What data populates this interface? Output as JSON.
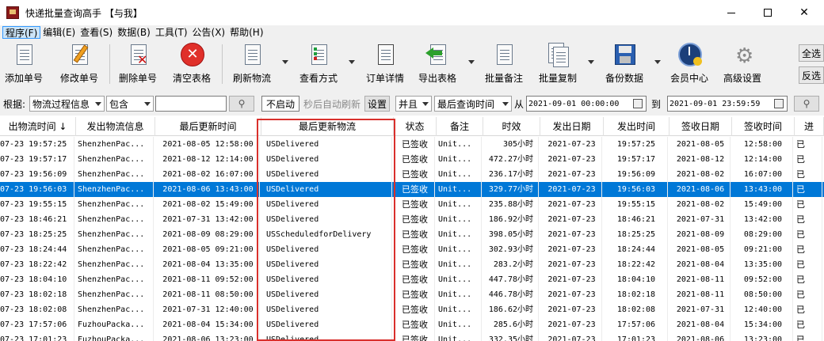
{
  "window": {
    "title": "快递批量查询高手 【与我】"
  },
  "menu": [
    {
      "label": "程序(F)",
      "active": true
    },
    {
      "label": "编辑(E)"
    },
    {
      "label": "查看(S)"
    },
    {
      "label": "数据(B)"
    },
    {
      "label": "工具(T)"
    },
    {
      "label": "公告(X)"
    },
    {
      "label": "帮助(H)"
    }
  ],
  "toolbar": {
    "buttons": [
      {
        "label": "添加单号",
        "icon": "document-icon"
      },
      {
        "label": "修改单号",
        "icon": "pencil-icon"
      },
      {
        "label": "删除单号",
        "icon": "delete-icon"
      },
      {
        "label": "清空表格",
        "icon": "clear-icon"
      },
      {
        "label": "刷新物流",
        "icon": "refresh-icon"
      },
      {
        "label": "查看方式",
        "icon": "view-icon"
      },
      {
        "label": "订单详情",
        "icon": "details-icon"
      },
      {
        "label": "导出表格",
        "icon": "export-icon"
      },
      {
        "label": "批量备注",
        "icon": "note-icon"
      },
      {
        "label": "批量复制",
        "icon": "copy-icon"
      },
      {
        "label": "备份数据",
        "icon": "save-icon"
      },
      {
        "label": "会员中心",
        "icon": "member-icon"
      },
      {
        "label": "高级设置",
        "icon": "gear-icon"
      }
    ],
    "select_all": "全选",
    "invert": "反选"
  },
  "filter": {
    "by_label": "根据:",
    "field": "物流过程信息",
    "op": "包含",
    "value": "",
    "auto_refresh": "不启动",
    "auto_refresh_hint": "秒后自动刷新",
    "settings": "设置",
    "logic": "并且",
    "time_field": "最后查询时间",
    "from_label": "从",
    "from_value": "2021-09-01 00:00:00",
    "to_label": "到",
    "to_value": "2021-09-01 23:59:59"
  },
  "colors": {
    "selected_row": "#0078d7",
    "highlight_box": "#d9302c"
  },
  "table": {
    "columns": [
      "出物流时间 ↓",
      "发出物流信息",
      "最后更新时间",
      "最后更新物流",
      "状态",
      "备注",
      "时效",
      "发出日期",
      "发出时间",
      "签收日期",
      "签收时间",
      "进"
    ],
    "selected_row": 3,
    "rows": [
      [
        "07-23 19:57:25",
        "ShenzhenPac...",
        "2021-08-05 12:58:00",
        "USDelivered",
        "已签收",
        "Unit...",
        "305小时",
        "2021-07-23",
        "19:57:25",
        "2021-08-05",
        "12:58:00",
        "已"
      ],
      [
        "07-23 19:57:17",
        "ShenzhenPac...",
        "2021-08-12 12:14:00",
        "USDelivered",
        "已签收",
        "Unit...",
        "472.27小时",
        "2021-07-23",
        "19:57:17",
        "2021-08-12",
        "12:14:00",
        "已"
      ],
      [
        "07-23 19:56:09",
        "ShenzhenPac...",
        "2021-08-02 16:07:00",
        "USDelivered",
        "已签收",
        "Unit...",
        "236.17小时",
        "2021-07-23",
        "19:56:09",
        "2021-08-02",
        "16:07:00",
        "已"
      ],
      [
        "07-23 19:56:03",
        "ShenzhenPac...",
        "2021-08-06 13:43:00",
        "USDelivered",
        "已签收",
        "Unit...",
        "329.77小时",
        "2021-07-23",
        "19:56:03",
        "2021-08-06",
        "13:43:00",
        "已"
      ],
      [
        "07-23 19:55:15",
        "ShenzhenPac...",
        "2021-08-02 15:49:00",
        "USDelivered",
        "已签收",
        "Unit...",
        "235.88小时",
        "2021-07-23",
        "19:55:15",
        "2021-08-02",
        "15:49:00",
        "已"
      ],
      [
        "07-23 18:46:21",
        "ShenzhenPac...",
        "2021-07-31 13:42:00",
        "USDelivered",
        "已签收",
        "Unit...",
        "186.92小时",
        "2021-07-23",
        "18:46:21",
        "2021-07-31",
        "13:42:00",
        "已"
      ],
      [
        "07-23 18:25:25",
        "ShenzhenPac...",
        "2021-08-09 08:29:00",
        "USScheduledforDelivery",
        "已签收",
        "Unit...",
        "398.05小时",
        "2021-07-23",
        "18:25:25",
        "2021-08-09",
        "08:29:00",
        "已"
      ],
      [
        "07-23 18:24:44",
        "ShenzhenPac...",
        "2021-08-05 09:21:00",
        "USDelivered",
        "已签收",
        "Unit...",
        "302.93小时",
        "2021-07-23",
        "18:24:44",
        "2021-08-05",
        "09:21:00",
        "已"
      ],
      [
        "07-23 18:22:42",
        "ShenzhenPac...",
        "2021-08-04 13:35:00",
        "USDelivered",
        "已签收",
        "Unit...",
        "283.2小时",
        "2021-07-23",
        "18:22:42",
        "2021-08-04",
        "13:35:00",
        "已"
      ],
      [
        "07-23 18:04:10",
        "ShenzhenPac...",
        "2021-08-11 09:52:00",
        "USDelivered",
        "已签收",
        "Unit...",
        "447.78小时",
        "2021-07-23",
        "18:04:10",
        "2021-08-11",
        "09:52:00",
        "已"
      ],
      [
        "07-23 18:02:18",
        "ShenzhenPac...",
        "2021-08-11 08:50:00",
        "USDelivered",
        "已签收",
        "Unit...",
        "446.78小时",
        "2021-07-23",
        "18:02:18",
        "2021-08-11",
        "08:50:00",
        "已"
      ],
      [
        "07-23 18:02:08",
        "ShenzhenPac...",
        "2021-07-31 12:40:00",
        "USDelivered",
        "已签收",
        "Unit...",
        "186.62小时",
        "2021-07-23",
        "18:02:08",
        "2021-07-31",
        "12:40:00",
        "已"
      ],
      [
        "07-23 17:57:06",
        "FuzhouPacka...",
        "2021-08-04 15:34:00",
        "USDelivered",
        "已签收",
        "Unit...",
        "285.6小时",
        "2021-07-23",
        "17:57:06",
        "2021-08-04",
        "15:34:00",
        "已"
      ],
      [
        "07-23 17:01:23",
        "FuzhouPacka...",
        "2021-08-06 13:23:00",
        "USDelivered",
        "已签收",
        "Unit...",
        "332.35小时",
        "2021-07-23",
        "17:01:23",
        "2021-08-06",
        "13:23:00",
        "已"
      ]
    ]
  }
}
